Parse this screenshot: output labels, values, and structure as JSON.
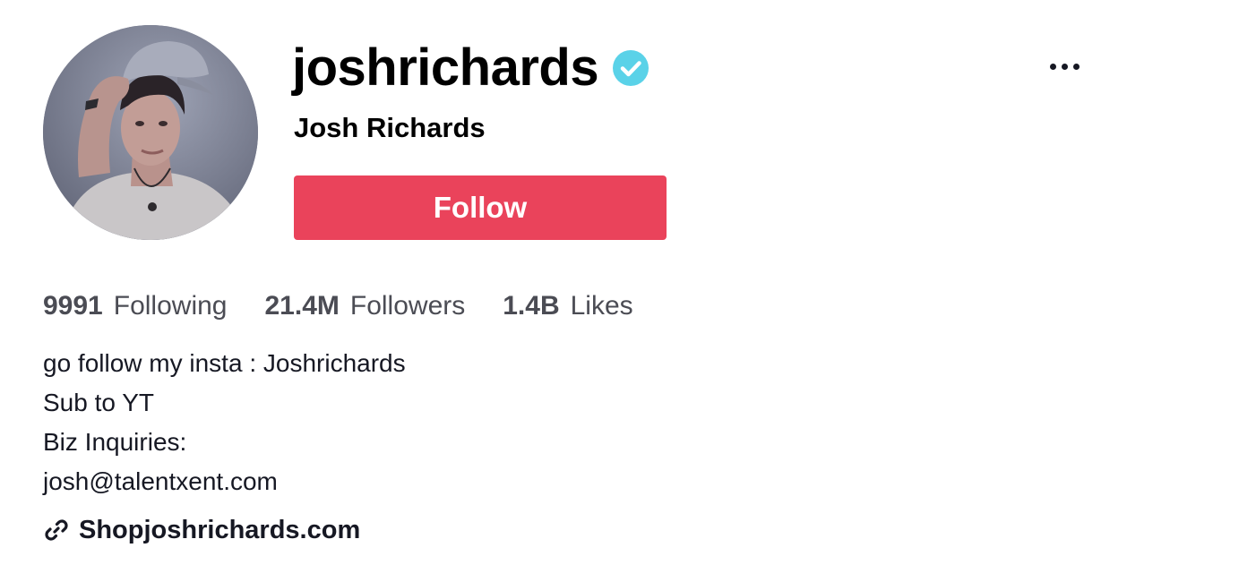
{
  "profile": {
    "username": "joshrichards",
    "display_name": "Josh Richards",
    "verified": true,
    "verified_color": "#5ad2e8",
    "avatar_icon": "profile-photo"
  },
  "actions": {
    "follow_label": "Follow",
    "follow_color": "#ea435b",
    "more_icon": "more-horizontal-icon"
  },
  "stats": [
    {
      "value": "9991",
      "label": "Following"
    },
    {
      "value": "21.4M",
      "label": "Followers"
    },
    {
      "value": "1.4B",
      "label": "Likes"
    }
  ],
  "bio": {
    "lines": [
      "go follow my insta : Joshrichards",
      "Sub to YT",
      "Biz Inquiries:",
      "josh@talentxent.com"
    ]
  },
  "link": {
    "icon": "link-icon",
    "text": "Shopjoshrichards.com"
  }
}
